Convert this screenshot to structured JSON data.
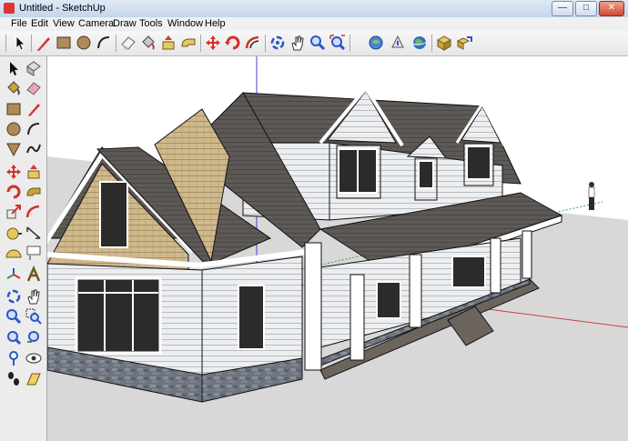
{
  "window": {
    "title": "Untitled - SketchUp",
    "controls": {
      "minimize": "—",
      "maximize": "□",
      "close": "✕"
    }
  },
  "menu": [
    "File",
    "Edit",
    "View",
    "Camera",
    "Draw",
    "Tools",
    "Window",
    "Help"
  ],
  "toolbar": [
    "select-arrow-icon",
    "pencil-line-icon",
    "rectangle-icon",
    "circle-icon",
    "arc-icon",
    "eraser-icon",
    "paint-bucket-icon",
    "push-pull-icon",
    "follow-me-icon",
    "move-icon",
    "rotate-icon",
    "offset-icon",
    "orbit-icon",
    "pan-hand-icon",
    "zoom-icon",
    "zoom-extents-icon",
    "get-models-icon",
    "share-model-icon",
    "google-earth-icon",
    "components-icon",
    "share-component-icon"
  ],
  "sidebar": [
    [
      "select-arrow-icon",
      "make-component-icon"
    ],
    [
      "paint-bucket-icon",
      "eraser-icon"
    ],
    [
      "rectangle-icon",
      "pencil-line-icon"
    ],
    [
      "circle-icon",
      "arc-icon"
    ],
    [
      "polygon-icon",
      "freehand-icon"
    ],
    [
      "move-icon",
      "push-pull-icon"
    ],
    [
      "rotate-icon",
      "follow-me-icon"
    ],
    [
      "scale-icon",
      "offset-icon"
    ],
    [
      "tape-measure-icon",
      "dimension-icon"
    ],
    [
      "protractor-icon",
      "text-icon"
    ],
    [
      "axes-icon",
      "3d-text-icon"
    ],
    [
      "orbit-icon",
      "pan-hand-icon"
    ],
    [
      "zoom-icon",
      "zoom-window-icon"
    ],
    [
      "zoom-extents-icon",
      "previous-view-icon"
    ],
    [
      "position-camera-icon",
      "look-around-icon"
    ],
    [
      "walk-icon",
      "section-plane-icon"
    ]
  ],
  "scene": {
    "sky_color": "#ffffff",
    "ground_color": "#d8d8d8",
    "roof_color": "#5c5956",
    "siding_color": "#eceef0",
    "shingle_gable_color": "#cfb98d",
    "stone_color": "#6f7580",
    "axis_colors": {
      "red": "#c84040",
      "green": "#40a040",
      "blue": "#4040c8"
    }
  }
}
